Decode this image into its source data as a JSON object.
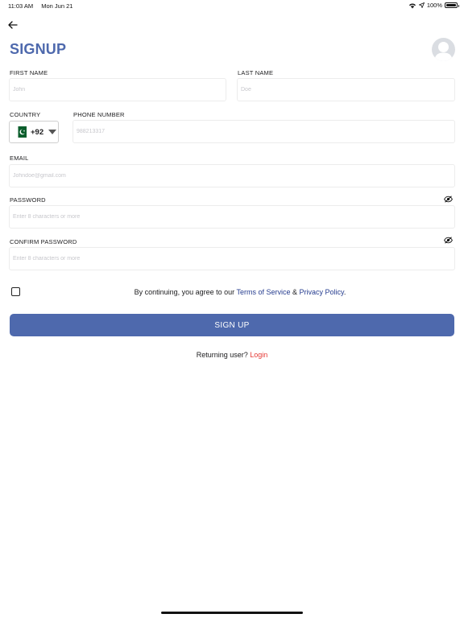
{
  "status_bar": {
    "time": "11:03 AM",
    "date": "Mon Jun 21",
    "battery": "100%",
    "wifi_icon": "wifi-icon",
    "location_icon": "location-arrow-icon"
  },
  "header": {
    "back_icon": "arrow-left-icon",
    "title": "SIGNUP",
    "avatar_icon": "user-avatar-icon"
  },
  "form": {
    "first_name": {
      "label": "FIRST NAME",
      "placeholder": "John",
      "value": ""
    },
    "last_name": {
      "label": "LAST NAME",
      "placeholder": "Doe",
      "value": ""
    },
    "country": {
      "label": "COUNTRY",
      "dial_code": "+92",
      "flag_icon": "pakistan-flag-icon"
    },
    "phone": {
      "label": "PHONE NUMBER",
      "placeholder": "988213317",
      "value": ""
    },
    "email": {
      "label": "EMAIL",
      "placeholder": "Johndoe@gmail.com",
      "value": ""
    },
    "password": {
      "label": "PASSWORD",
      "placeholder": "Enter 8 characters or more",
      "value": "",
      "toggle_icon": "eye-slash-icon"
    },
    "confirm_password": {
      "label": "CONFIRM PASSWORD",
      "placeholder": "Enter 8 characters or more",
      "value": "",
      "toggle_icon": "eye-slash-icon"
    }
  },
  "terms": {
    "prefix": "By continuing, you agree to our ",
    "terms_link": "Terms of Service",
    "separator": " & ",
    "privacy_link": "Privacy Policy",
    "suffix": ".",
    "checked": false
  },
  "signup_button": {
    "label": "SIGN UP"
  },
  "footer": {
    "prompt": "Returning user? ",
    "login_link": "Login"
  },
  "colors": {
    "accent": "#4e69ad",
    "link": "#253c8f",
    "login_link": "#e53935"
  }
}
